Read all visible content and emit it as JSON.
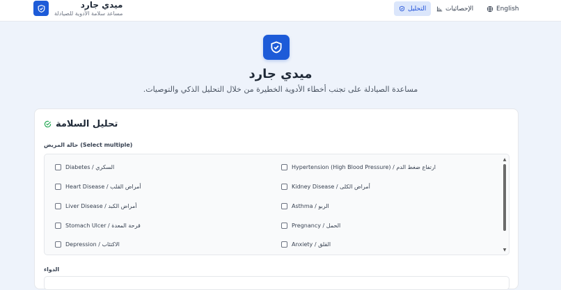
{
  "header": {
    "brand_title": "ميدي جارد",
    "brand_subtitle": "مساعد سلامة الأدوية للصيادلة",
    "nav": {
      "analysis": "التحليل",
      "stats": "الإحصائيات",
      "language": "English"
    }
  },
  "hero": {
    "title": "ميدي جارد",
    "subtitle": "مساعدة الصيادلة على تجنب أخطاء الأدوية الخطيرة من خلال التحليل الذكي والتوصيات."
  },
  "card": {
    "title": "تحليل السلامة",
    "conditions_label": "حالة المريض (Select multiple)",
    "conditions": [
      {
        "label": "Diabetes / السكري",
        "checked": false
      },
      {
        "label": "Hypertension (High Blood Pressure) / ارتفاع ضغط الدم",
        "checked": false
      },
      {
        "label": "Heart Disease / أمراض القلب",
        "checked": false
      },
      {
        "label": "Kidney Disease / أمراض الكلى",
        "checked": false
      },
      {
        "label": "Liver Disease / أمراض الكبد",
        "checked": false
      },
      {
        "label": "Asthma / الربو",
        "checked": false
      },
      {
        "label": "Stomach Ulcer / قرحة المعدة",
        "checked": false
      },
      {
        "label": "Pregnancy / الحمل",
        "checked": false
      },
      {
        "label": "Depression / الاكتئاب",
        "checked": false
      },
      {
        "label": "Anxiety / القلق",
        "checked": false
      }
    ],
    "drug_label": "الدواء"
  },
  "colors": {
    "accent": "#1d5bd8",
    "success": "#16a34a",
    "background": "#eef3fb"
  },
  "icons": {
    "logo": "shield-icon",
    "analysis": "shield-icon",
    "stats": "bar-chart-icon",
    "language": "globe-icon",
    "title_check": "check-circle-icon"
  }
}
